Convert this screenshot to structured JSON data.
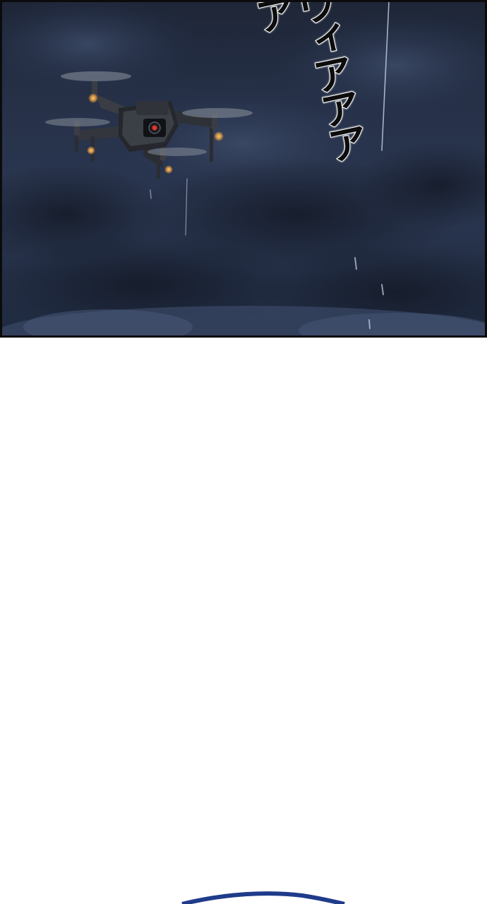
{
  "panel_top": {
    "sound_effect": "ヴィアアアア",
    "subject": "drone-illustration",
    "colors": {
      "sky_dark": "#1e2637",
      "sky_mid": "#2a3650",
      "light_orange": "#f4a13c",
      "camera_red": "#e8332b",
      "border": "#0b0b0d"
    }
  },
  "panel_next": {
    "edge_color": "#1f3b8a"
  }
}
